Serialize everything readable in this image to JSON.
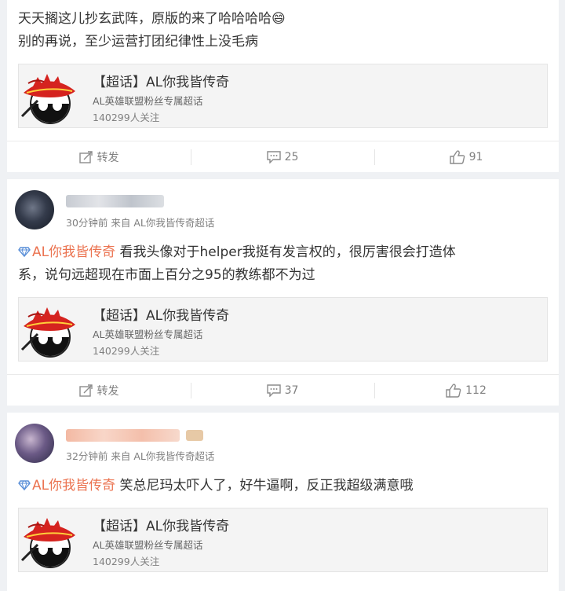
{
  "posts": [
    {
      "text_line1": "天天搁这儿抄玄武阵，原版的来了哈哈哈哈😄",
      "text_line2": "别的再说，至少运营打团纪律性上没毛病",
      "topic": {
        "title": "【超话】AL你我皆传奇",
        "subtitle": "AL英雄联盟粉丝专属超话",
        "fans": "140299人关注"
      },
      "actions": {
        "repost": "转发",
        "comments": "25",
        "likes": "91"
      }
    },
    {
      "meta": "30分钟前 来自 AL你我皆传奇超话",
      "tag": "AL你我皆传奇",
      "text_line1": "看我头像对于helper我挺有发言权的，很厉害很会打造体",
      "text_line2": "系，说句远超现在市面上百分之95的教练都不为过",
      "topic": {
        "title": "【超话】AL你我皆传奇",
        "subtitle": "AL英雄联盟粉丝专属超话",
        "fans": "140299人关注"
      },
      "actions": {
        "repost": "转发",
        "comments": "37",
        "likes": "112"
      }
    },
    {
      "meta": "32分钟前 来自 AL你我皆传奇超话",
      "tag": "AL你我皆传奇",
      "text_line1": "笑总尼玛太吓人了，好牛逼啊，反正我超级满意哦",
      "topic": {
        "title": "【超话】AL你我皆传奇",
        "subtitle": "AL英雄联盟粉丝专属超话",
        "fans": "140299人关注"
      }
    }
  ],
  "colors": {
    "tag": "#eb7350",
    "background": "#eff1f4",
    "meta": "#808080"
  }
}
